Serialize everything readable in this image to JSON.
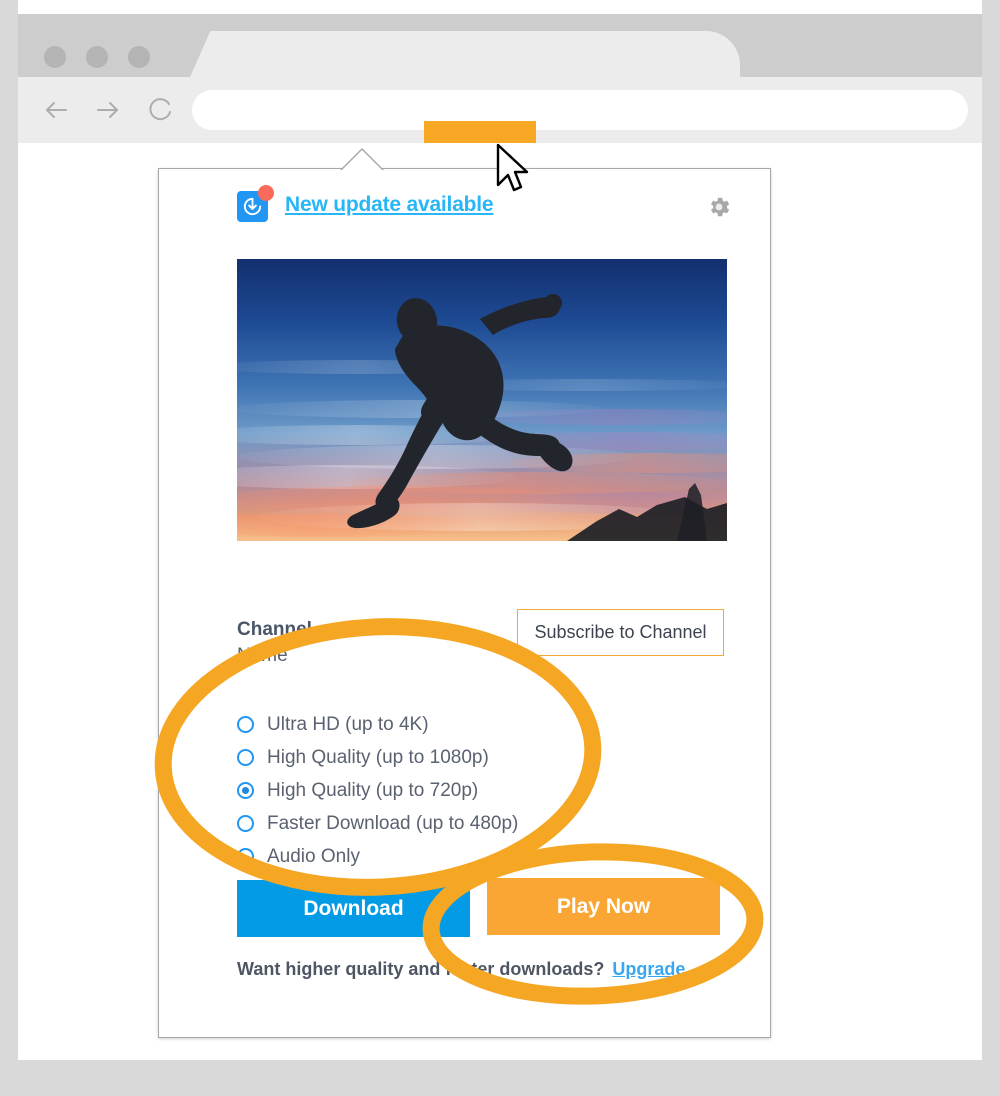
{
  "browser": {
    "window_controls": [
      "dot",
      "dot",
      "dot"
    ],
    "nav": {
      "back_label": "Back",
      "forward_label": "Forward",
      "reload_label": "Reload"
    },
    "url_value": "",
    "url_placeholder": "",
    "tab_title": "",
    "extension_button_label": ""
  },
  "popup": {
    "header": {
      "logo_name": "downloader-logo-icon",
      "badge": "",
      "update_link": "New update available",
      "settings_label": "Settings"
    },
    "thumbnail": {
      "alt": "Silhouette of person jumping at sunset"
    },
    "channel": {
      "label": "Channel",
      "name": "Name",
      "subscribe_label": "Subscribe to Channel"
    },
    "quality_options": [
      {
        "label": "Ultra HD (up to 4K)",
        "selected": false
      },
      {
        "label": "High Quality (up to 1080p)",
        "selected": false
      },
      {
        "label": "High Quality (up to 720p)",
        "selected": true
      },
      {
        "label": "Faster Download (up to 480p)",
        "selected": false
      },
      {
        "label": "Audio Only",
        "selected": false
      }
    ],
    "actions": {
      "download_label": "Download",
      "play_label": "Play Now"
    },
    "footer": {
      "text": "Want higher quality and faster downloads?",
      "link": "Upgrade"
    }
  },
  "colors": {
    "accent_orange": "#f9a825",
    "annotation_orange": "#f5a623",
    "download_blue": "#039be5",
    "play_orange": "#faa634",
    "link_blue": "#29b6f6",
    "radio_blue": "#2196f3",
    "badge_red": "#fa6b5a",
    "page_background": "#d9d9d9"
  }
}
